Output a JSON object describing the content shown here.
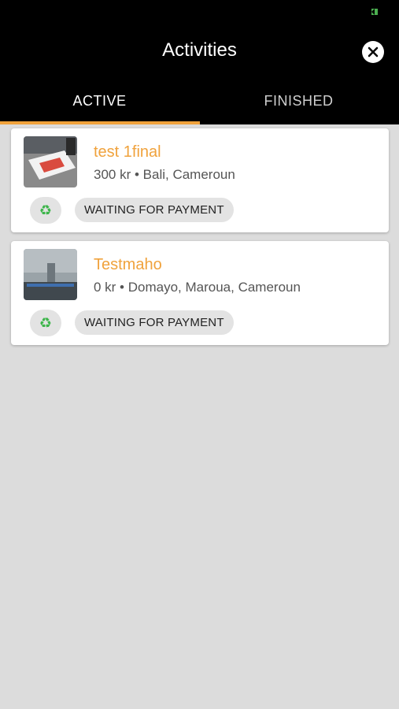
{
  "header": {
    "title": "Activities"
  },
  "icons": {
    "close": "close-icon",
    "recycle": "recycle-icon",
    "status": "battery-icon"
  },
  "colors": {
    "accent": "#f0a23c",
    "header_bg": "#000000",
    "page_bg": "#dcdcdc",
    "recycle": "#3cb54a"
  },
  "tabs": [
    {
      "label": "ACTIVE",
      "active": true
    },
    {
      "label": "FINISHED",
      "active": false
    }
  ],
  "activities": [
    {
      "title": "test 1final",
      "subtitle": "300 kr • Bali, Cameroun",
      "status": "WAITING FOR PAYMENT",
      "recycle_glyph": "♻"
    },
    {
      "title": "Testmaho",
      "subtitle": "0 kr • Domayo, Maroua, Cameroun",
      "status": "WAITING FOR PAYMENT",
      "recycle_glyph": "♻"
    }
  ]
}
